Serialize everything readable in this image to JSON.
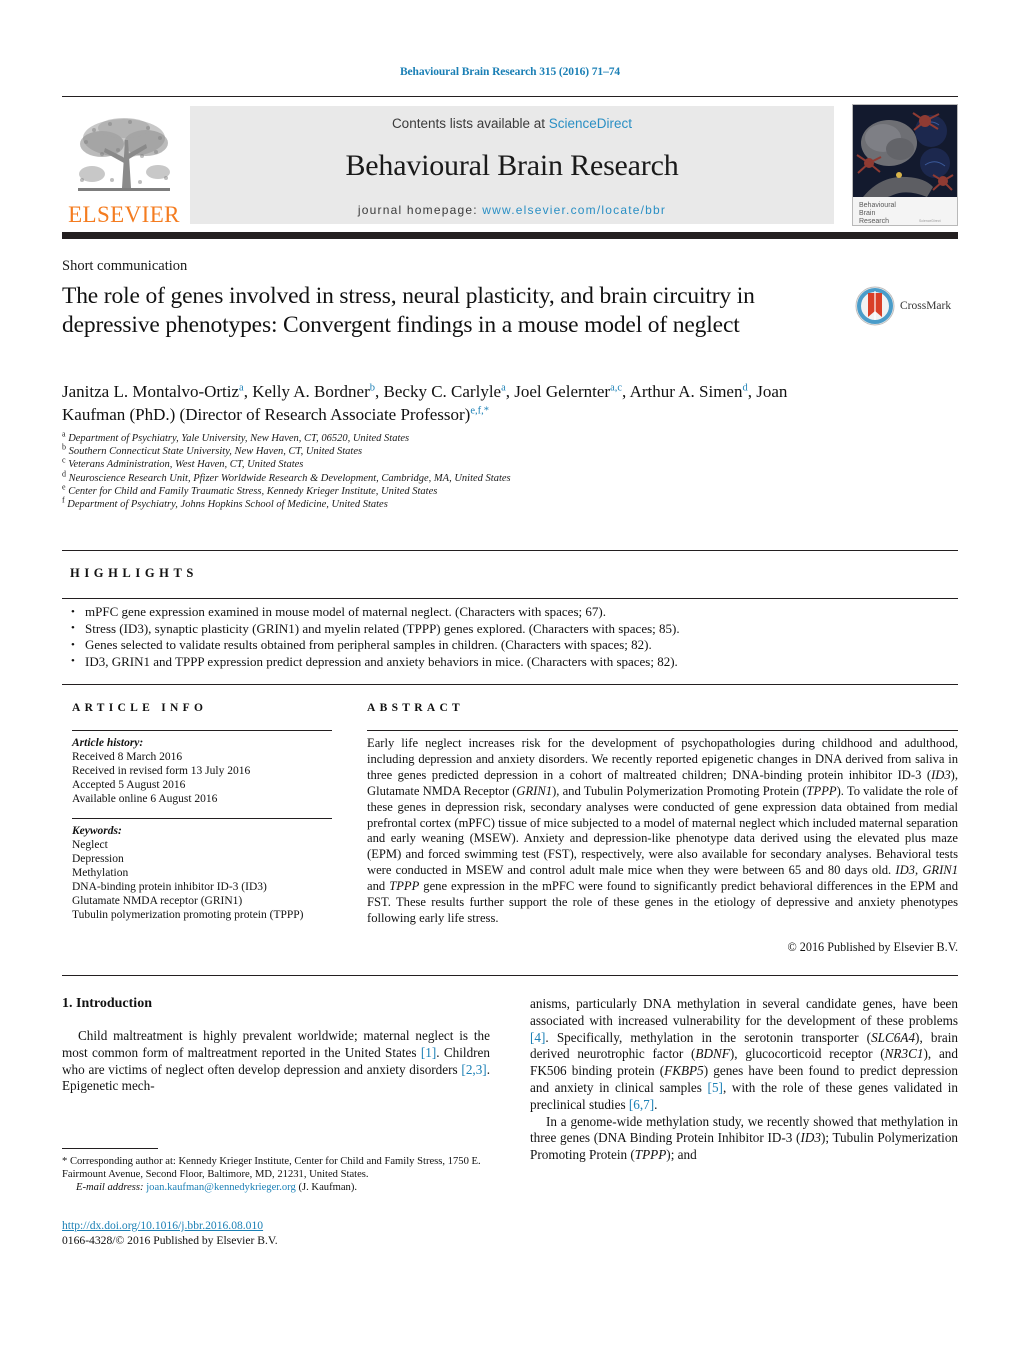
{
  "running_head": "Behavioural Brain Research 315 (2016) 71–74",
  "masthead": {
    "contents_prefix": "Contents lists available at ",
    "sciencedirect": "ScienceDirect",
    "journal_name": "Behavioural Brain Research",
    "homepage_prefix": "journal homepage:",
    "homepage_url": "www.elsevier.com/locate/bbr",
    "publisher_wordmark": "ELSEVIER",
    "cover_caption_line1": "Behavioural",
    "cover_caption_line2": "Brain",
    "cover_caption_line3": "Research",
    "accent_orange": "#f47c20",
    "link_blue": "#2a8fc4",
    "band_gray": "#e9e9e9"
  },
  "article": {
    "type": "Short communication",
    "title": "The role of genes involved in stress, neural plasticity, and brain circuitry in depressive phenotypes: Convergent findings in a mouse model of neglect",
    "crossmark_label": "CrossMark",
    "authors_line1": "Janitza L. Montalvo-Ortiz",
    "authors_line1_sup": "a",
    "authors_html": "Janitza L. Montalvo-Ortiz<sup>a</sup>, Kelly A. Bordner<sup>b</sup>, Becky C. Carlyle<sup>a</sup>, Joel Gelernter<sup>a,c</sup>, Arthur A. Simen<sup>d</sup>, Joan Kaufman (PhD.) (Director of Research Associate Professor)<sup>e,f,*</sup>",
    "affiliations": [
      {
        "mark": "a",
        "text": "Department of Psychiatry, Yale University, New Haven, CT, 06520, United States"
      },
      {
        "mark": "b",
        "text": "Southern Connecticut State University, New Haven, CT, United States"
      },
      {
        "mark": "c",
        "text": "Veterans Administration, West Haven, CT, United States"
      },
      {
        "mark": "d",
        "text": "Neuroscience Research Unit, Pfizer Worldwide Research & Development, Cambridge, MA, United States"
      },
      {
        "mark": "e",
        "text": "Center for Child and Family Traumatic Stress, Kennedy Krieger Institute, United States"
      },
      {
        "mark": "f",
        "text": "Department of Psychiatry, Johns Hopkins School of Medicine, United States"
      }
    ]
  },
  "highlights": {
    "heading": "HIGHLIGHTS",
    "items": [
      "mPFC gene expression examined in mouse model of maternal neglect. (Characters with spaces; 67).",
      "Stress (ID3), synaptic plasticity (GRIN1) and myelin related (TPPP) genes explored. (Characters with spaces; 85).",
      "Genes selected to validate results obtained from peripheral samples in children. (Characters with spaces; 82).",
      "ID3, GRIN1 and TPPP expression predict depression and anxiety behaviors in mice. (Characters with spaces; 82)."
    ]
  },
  "article_info": {
    "heading": "ARTICLE INFO",
    "history_label": "Article history:",
    "history": [
      "Received 8 March 2016",
      "Received in revised form 13 July 2016",
      "Accepted 5 August 2016",
      "Available online 6 August 2016"
    ],
    "keywords_label": "Keywords:",
    "keywords": [
      "Neglect",
      "Depression",
      "Methylation",
      "DNA-binding protein inhibitor ID-3 (ID3)",
      "Glutamate NMDA receptor (GRIN1)",
      "Tubulin polymerization promoting protein (TPPP)"
    ]
  },
  "abstract": {
    "heading": "ABSTRACT",
    "html": "Early life neglect increases risk for the development of psychopathologies during childhood and adulthood, including depression and anxiety disorders. We recently reported epigenetic changes in DNA derived from saliva in three genes predicted depression in a cohort of maltreated children; DNA-binding protein inhibitor ID-3 (<span class=\"ital\">ID3</span>), Glutamate NMDA Receptor (<span class=\"ital\">GRIN1</span>), and Tubulin Polymerization Promoting Protein (<span class=\"ital\">TPPP</span>). To validate the role of these genes in depression risk, secondary analyses were conducted of gene expression data obtained from medial prefrontal cortex (mPFC) tissue of mice subjected to a model of maternal neglect which included maternal separation and early weaning (MSEW). Anxiety and depression-like phenotype data derived using the elevated plus maze (EPM) and forced swimming test (FST), respectively, were also available for secondary analyses. Behavioral tests were conducted in MSEW and control adult male mice when they were between 65 and 80 days old. <span class=\"ital\">ID3</span>, <span class=\"ital\">GRIN1</span> and <span class=\"ital\">TPPP</span> gene expression in the mPFC were found to significantly predict behavioral differences in the EPM and FST. These results further support the role of these genes in the etiology of depressive and anxiety phenotypes following early life stress.",
    "copyright": "© 2016 Published by Elsevier B.V."
  },
  "body": {
    "section_heading": "1. Introduction",
    "left_paragraph_html": "Child maltreatment is highly prevalent worldwide; maternal neglect is the most common form of maltreatment reported in the United States <span class=\"ref\">[1]</span>. Children who are victims of neglect often develop depression and anxiety disorders <span class=\"ref\">[2,3]</span>. Epigenetic mech-",
    "right_paragraph1_html": "anisms, particularly DNA methylation in several candidate genes, have been associated with increased vulnerability for the development of these problems <span class=\"ref\">[4]</span>. Specifically, methylation in the serotonin transporter (<span class=\"ital\">SLC6A4</span>), brain derived neurotrophic factor (<span class=\"ital\">BDNF</span>), glucocorticoid receptor (<span class=\"ital\">NR3C1</span>), and FK506 binding protein (<span class=\"ital\">FKBP5</span>) genes have been found to predict depression and anxiety in clinical samples <span class=\"ref\">[5]</span>, with the role of these genes validated in preclinical studies <span class=\"ref\">[6,7]</span>.",
    "right_paragraph2_html": "In a genome-wide methylation study, we recently showed that methylation in three genes (DNA Binding Protein Inhibitor ID-3 (<span class=\"ital\">ID3</span>); Tubulin Polymerization Promoting Protein (<span class=\"ital\">TPPP</span>); and"
  },
  "footer": {
    "corresponding_html": "<span class=\"star\">*</span> Corresponding author at: Kennedy Krieger Institute, Center for Child and Family Stress, 1750 E. Fairmount Avenue, Second Floor, Baltimore, MD, 21231, United States.",
    "email_label": "E-mail address:",
    "email": "joan.kaufman@kennedykrieger.org",
    "email_attrib": "(J. Kaufman).",
    "doi": "http://dx.doi.org/10.1016/j.bbr.2016.08.010",
    "issn_line": "0166-4328/© 2016 Published by Elsevier B.V."
  }
}
